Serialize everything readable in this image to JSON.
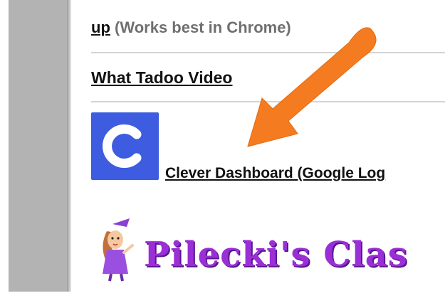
{
  "list": {
    "row1_link": "up",
    "row1_note": "(Works best in Chrome)",
    "row2_link": "What Tadoo Video",
    "row3_link": "Clever Dashboard (Google Log"
  },
  "clever_logo": {
    "letter": "C",
    "color": "#3d5ce0"
  },
  "banner": {
    "title": "Pilecki's Clas"
  },
  "colors": {
    "arrow": "#f47b20",
    "banner_text": "#9b2fd6",
    "gutter": "#b3b3b3"
  },
  "icons": [
    "clever-logo-icon",
    "arrow-annotation-icon",
    "girl-mascot-icon"
  ]
}
